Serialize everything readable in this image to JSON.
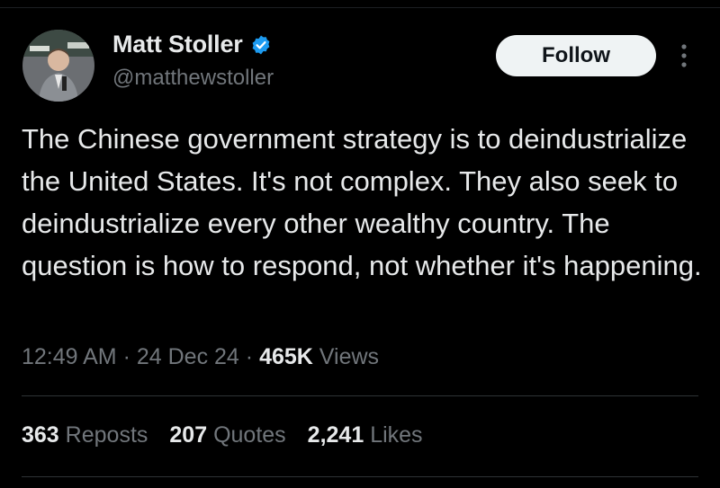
{
  "author": {
    "display_name": "Matt Stoller",
    "handle": "@matthewstoller",
    "verified_icon": "verified-badge-icon",
    "verified_color": "#1d9bf0"
  },
  "header": {
    "follow_label": "Follow",
    "more_icon": "more-vertical-icon"
  },
  "tweet": {
    "text": "The Chinese government strategy is to deindustrialize the United States. It's not complex. They also seek to deindustrialize every other wealthy country. The question is how to respond, not whether it's happening.",
    "time": "12:49 AM",
    "date": "24 Dec 24",
    "separator": "·",
    "views_count": "465K",
    "views_label": "Views"
  },
  "stats": {
    "reposts_count": "363",
    "reposts_label": "Reposts",
    "quotes_count": "207",
    "quotes_label": "Quotes",
    "likes_count": "2,241",
    "likes_label": "Likes"
  },
  "colors": {
    "background": "#000000",
    "text_primary": "#e7e9ea",
    "text_secondary": "#71767b",
    "divider": "#2f3336",
    "follow_bg": "#eff3f4"
  }
}
